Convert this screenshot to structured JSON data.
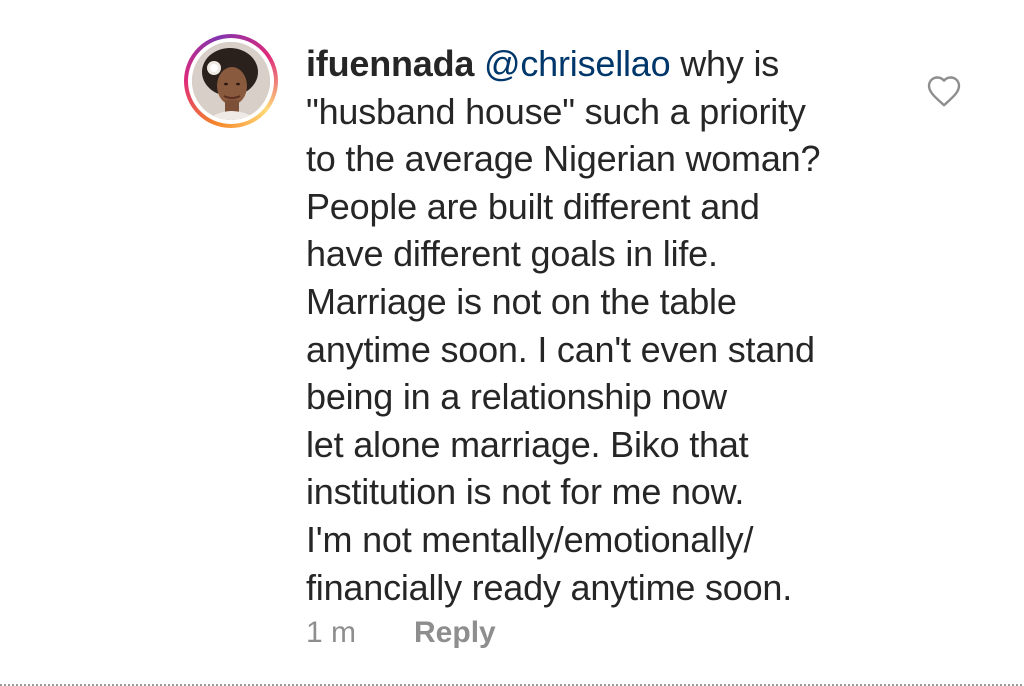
{
  "comment": {
    "username": "ifuennada",
    "mention": "@chrisellao",
    "first_line_rest": " why is",
    "lines": [
      "\"husband house\" such a priority",
      "to the average Nigerian woman?",
      "People are built different and",
      "have different goals in life.",
      "Marriage is not on the table",
      "anytime soon. I can't even stand",
      "being in a relationship now",
      "let alone marriage. Biko that",
      "institution is not for me now.",
      "I'm not mentally/emotionally/",
      "financially ready anytime soon."
    ],
    "timestamp": "1 m",
    "reply_label": "Reply",
    "like_icon": "heart-outline-icon",
    "avatar_icon": "profile-avatar"
  },
  "colors": {
    "text": "#262626",
    "mention": "#00376b",
    "muted": "#8e8e8e",
    "ring_start": "#f58529",
    "ring_end": "#dd2a7b"
  }
}
